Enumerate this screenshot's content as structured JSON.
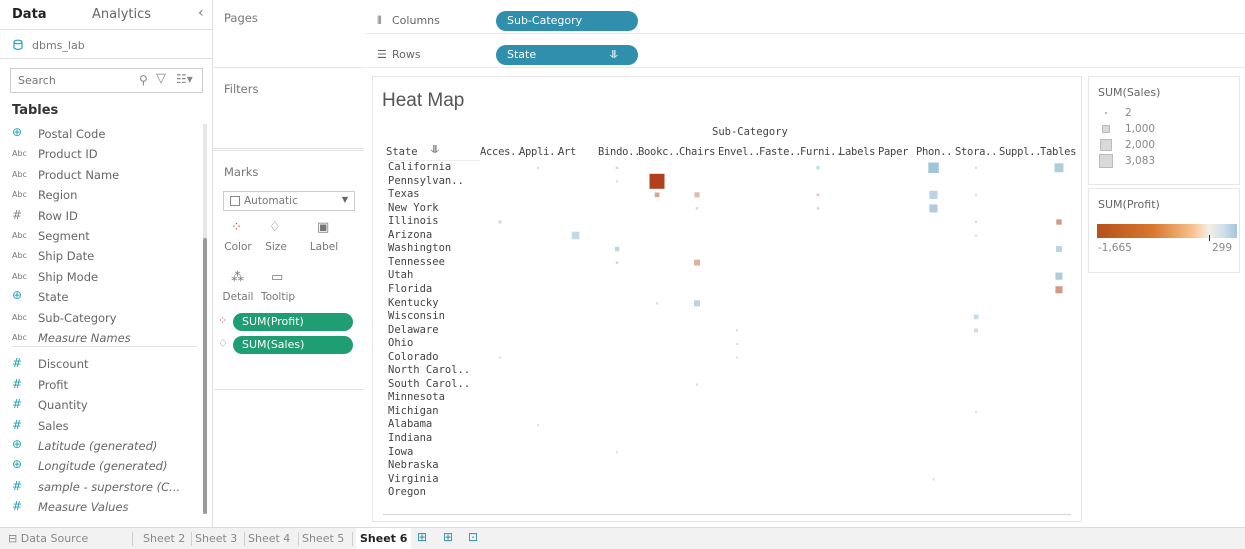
{
  "data_pane": {
    "tab_data": "Data",
    "tab_analytics": "Analytics",
    "collapse": "‹",
    "datasource": "dbms_lab",
    "search_placeholder": "Search",
    "tables_heading": "Tables",
    "fields": [
      {
        "icon": "globe-icon",
        "glyph": "⊕",
        "label": "Postal Code",
        "italic": false,
        "kind": "globe"
      },
      {
        "icon": "string-icon",
        "glyph": "Abc",
        "label": "Product ID",
        "italic": false,
        "kind": "abc"
      },
      {
        "icon": "string-icon",
        "glyph": "Abc",
        "label": "Product Name",
        "italic": false,
        "kind": "abc"
      },
      {
        "icon": "string-icon",
        "glyph": "Abc",
        "label": "Region",
        "italic": false,
        "kind": "abc"
      },
      {
        "icon": "number-icon",
        "glyph": "#",
        "label": "Row ID",
        "italic": false,
        "kind": "hash"
      },
      {
        "icon": "string-icon",
        "glyph": "Abc",
        "label": "Segment",
        "italic": false,
        "kind": "abc"
      },
      {
        "icon": "string-icon",
        "glyph": "Abc",
        "label": "Ship Date",
        "italic": false,
        "kind": "abc"
      },
      {
        "icon": "string-icon",
        "glyph": "Abc",
        "label": "Ship Mode",
        "italic": false,
        "kind": "abc"
      },
      {
        "icon": "globe-icon",
        "glyph": "⊕",
        "label": "State",
        "italic": false,
        "kind": "globe"
      },
      {
        "icon": "string-icon",
        "glyph": "Abc",
        "label": "Sub-Category",
        "italic": false,
        "kind": "abc"
      },
      {
        "icon": "string-icon",
        "glyph": "Abc",
        "label": "Measure Names",
        "italic": true,
        "kind": "abc"
      },
      {
        "icon": "number-icon",
        "glyph": "#",
        "label": "Discount",
        "italic": false,
        "kind": "hash meas"
      },
      {
        "icon": "number-icon",
        "glyph": "#",
        "label": "Profit",
        "italic": false,
        "kind": "hash meas"
      },
      {
        "icon": "number-icon",
        "glyph": "#",
        "label": "Quantity",
        "italic": false,
        "kind": "hash meas"
      },
      {
        "icon": "number-icon",
        "glyph": "#",
        "label": "Sales",
        "italic": false,
        "kind": "hash meas"
      },
      {
        "icon": "globe-icon",
        "glyph": "⊕",
        "label": "Latitude (generated)",
        "italic": true,
        "kind": "globe"
      },
      {
        "icon": "globe-icon",
        "glyph": "⊕",
        "label": "Longitude (generated)",
        "italic": true,
        "kind": "globe"
      },
      {
        "icon": "number-icon",
        "glyph": "#",
        "label": "sample - superstore (C...",
        "italic": true,
        "kind": "hash meas"
      },
      {
        "icon": "number-icon",
        "glyph": "#",
        "label": "Measure Values",
        "italic": true,
        "kind": "hash meas"
      }
    ]
  },
  "cards": {
    "pages": "Pages",
    "filters": "Filters",
    "marks": "Marks",
    "mark_type": "Automatic",
    "buttons": {
      "color": "Color",
      "size": "Size",
      "label": "Label",
      "detail": "Detail",
      "tooltip": "Tooltip"
    },
    "pill_profit": "SUM(Profit)",
    "pill_sales": "SUM(Sales)"
  },
  "shelves": {
    "columns_label": "Columns",
    "columns_pill": "Sub-Category",
    "rows_label": "Rows",
    "rows_pill": "State"
  },
  "viz": {
    "title": "Heat Map",
    "col_header_title": "Sub-Category",
    "row_header_title": "State"
  },
  "chart_data": {
    "type": "heatmap",
    "title": "Heat Map",
    "x_field": "Sub-Category",
    "y_field": "State",
    "size_measure": "SUM(Sales)",
    "color_measure": "SUM(Profit)",
    "columns": [
      "Acces..",
      "Appli..",
      "Art",
      "Bindo..",
      "Bookc..",
      "Chairs",
      "Envel..",
      "Faste..",
      "Furni..",
      "Labels",
      "Paper",
      "Phon..",
      "Stora..",
      "Suppl..",
      "Tables"
    ],
    "rows": [
      "California",
      "Pennsylvan..",
      "Texas",
      "New York",
      "Illinois",
      "Arizona",
      "Washington",
      "Tennessee",
      "Utah",
      "Florida",
      "Kentucky",
      "Wisconsin",
      "Delaware",
      "Ohio",
      "Colorado",
      "North Carol..",
      "South Carol..",
      "Minnesota",
      "Michigan",
      "Alabama",
      "Indiana",
      "Iowa",
      "Nebraska",
      "Virginia",
      "Oregon"
    ],
    "cells": [
      {
        "row": "California",
        "col": "Phon..",
        "sales": 1500,
        "profit": 250
      },
      {
        "row": "California",
        "col": "Tables",
        "sales": 1100,
        "profit": 200
      },
      {
        "row": "California",
        "col": "Furni..",
        "sales": 150,
        "profit": 100
      },
      {
        "row": "California",
        "col": "Bindo..",
        "sales": 100,
        "profit": 80
      },
      {
        "row": "California",
        "col": "Appli..",
        "sales": 60,
        "profit": 60
      },
      {
        "row": "California",
        "col": "Stora..",
        "sales": 60,
        "profit": 60
      },
      {
        "row": "Pennsylvan..",
        "col": "Bookc..",
        "sales": 3083,
        "profit": -1665
      },
      {
        "row": "Pennsylvan..",
        "col": "Bindo..",
        "sales": 60,
        "profit": -30
      },
      {
        "row": "Texas",
        "col": "Bookc..",
        "sales": 300,
        "profit": -300
      },
      {
        "row": "Texas",
        "col": "Chairs",
        "sales": 350,
        "profit": -150
      },
      {
        "row": "Texas",
        "col": "Phon..",
        "sales": 900,
        "profit": 150
      },
      {
        "row": "Texas",
        "col": "Furni..",
        "sales": 100,
        "profit": -80
      },
      {
        "row": "Texas",
        "col": "Stora..",
        "sales": 80,
        "profit": 40
      },
      {
        "row": "New York",
        "col": "Phon..",
        "sales": 900,
        "profit": 200
      },
      {
        "row": "New York",
        "col": "Furni..",
        "sales": 80,
        "profit": -40
      },
      {
        "row": "New York",
        "col": "Chairs",
        "sales": 100,
        "profit": 60
      },
      {
        "row": "Illinois",
        "col": "Acces..",
        "sales": 150,
        "profit": 80
      },
      {
        "row": "Illinois",
        "col": "Tables",
        "sales": 400,
        "profit": -400
      },
      {
        "row": "Illinois",
        "col": "Stora..",
        "sales": 80,
        "profit": 60
      },
      {
        "row": "Arizona",
        "col": "Art",
        "sales": 800,
        "profit": 120
      },
      {
        "row": "Arizona",
        "col": "Stora..",
        "sales": 80,
        "profit": 40
      },
      {
        "row": "Washington",
        "col": "Bindo..",
        "sales": 250,
        "profit": 150
      },
      {
        "row": "Washington",
        "col": "Tables",
        "sales": 500,
        "profit": 150
      },
      {
        "row": "Tennessee",
        "col": "Chairs",
        "sales": 500,
        "profit": -200
      },
      {
        "row": "Tennessee",
        "col": "Bindo..",
        "sales": 80,
        "profit": -80
      },
      {
        "row": "Utah",
        "col": "Tables",
        "sales": 700,
        "profit": 200
      },
      {
        "row": "Florida",
        "col": "Tables",
        "sales": 700,
        "profit": -400
      },
      {
        "row": "Kentucky",
        "col": "Chairs",
        "sales": 500,
        "profit": 150
      },
      {
        "row": "Kentucky",
        "col": "Bookc..",
        "sales": 80,
        "profit": 60
      },
      {
        "row": "Wisconsin",
        "col": "Stora..",
        "sales": 300,
        "profit": 100
      },
      {
        "row": "Delaware",
        "col": "Stora..",
        "sales": 200,
        "profit": 100
      },
      {
        "row": "Delaware",
        "col": "Envel..",
        "sales": 60,
        "profit": 60
      },
      {
        "row": "Ohio",
        "col": "Envel..",
        "sales": 60,
        "profit": 50
      },
      {
        "row": "Colorado",
        "col": "Acces..",
        "sales": 60,
        "profit": 50
      },
      {
        "row": "Colorado",
        "col": "Envel..",
        "sales": 60,
        "profit": 50
      },
      {
        "row": "South Carol..",
        "col": "Chairs",
        "sales": 80,
        "profit": 60
      },
      {
        "row": "Michigan",
        "col": "Stora..",
        "sales": 60,
        "profit": 50
      },
      {
        "row": "Alabama",
        "col": "Appli..",
        "sales": 60,
        "profit": 50
      },
      {
        "row": "Iowa",
        "col": "Bindo..",
        "sales": 60,
        "profit": 50
      },
      {
        "row": "Virginia",
        "col": "Phon..",
        "sales": 60,
        "profit": 50
      }
    ],
    "size_legend": {
      "title": "SUM(Sales)",
      "entries": [
        "2",
        "1,000",
        "2,000",
        "3,083"
      ]
    },
    "color_legend": {
      "title": "SUM(Profit)",
      "min": "-1,665",
      "max": "299",
      "min_value": -1665,
      "max_value": 299
    }
  },
  "bottom_tabs": {
    "data_source": "Data Source",
    "sheets": [
      "Sheet 2",
      "Sheet 3",
      "Sheet 4",
      "Sheet 5",
      "Sheet 6"
    ],
    "active": "Sheet 6"
  }
}
